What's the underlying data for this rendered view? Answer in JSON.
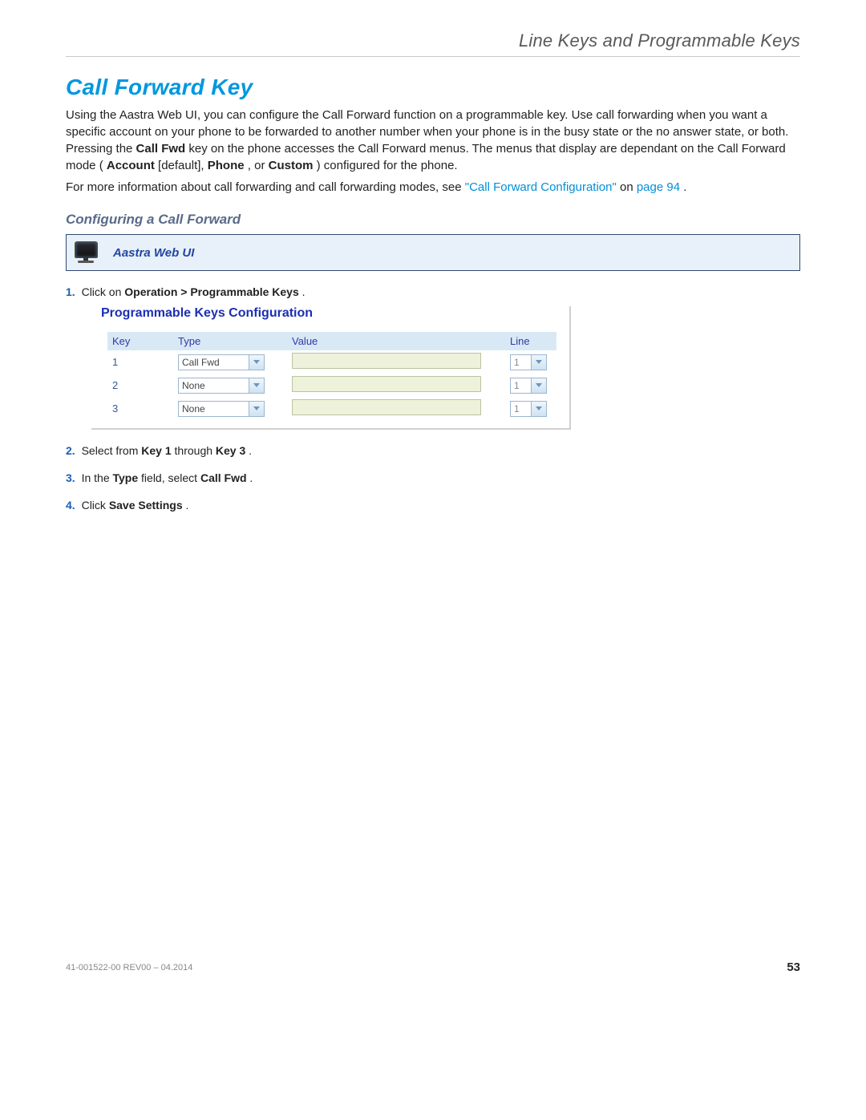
{
  "header": {
    "title": "Line Keys and Programmable Keys"
  },
  "h1": "Call Forward Key",
  "para1": {
    "t1": "Using the Aastra Web UI, you can configure the Call Forward function on a programmable key. Use call forwarding when you want a specific account on your phone to be forwarded to another number when your phone is in the busy state or the no answer state, or both. Pressing the ",
    "bold1": "Call Fwd",
    "t2": " key on the phone accesses the Call Forward menus. The menus that display are dependant on the Call Forward mode (",
    "bold2": "Account",
    "t3": " [default], ",
    "bold3": "Phone",
    "t4": ", or ",
    "bold4": "Custom",
    "t5": ") configured for the phone."
  },
  "para2": {
    "t1": "For more information about call forwarding and call forwarding modes, see ",
    "link1": "\"Call Forward Configuration\"",
    "t2": " on ",
    "link2": "page 94",
    "t3": "."
  },
  "h2": "Configuring a Call Forward",
  "webui_label": "Aastra Web UI",
  "steps": {
    "s1": {
      "num": "1.",
      "t1": "Click on ",
      "b1": "Operation > Programmable Keys",
      "t2": "."
    },
    "s2": {
      "num": "2.",
      "t1": "Select from ",
      "b1": "Key 1",
      "t2": " through ",
      "b2": "Key 3",
      "t3": "."
    },
    "s3": {
      "num": "3.",
      "t1": "In the ",
      "b1": "Type",
      "t2": " field, select ",
      "b2": "Call Fwd",
      "t3": "."
    },
    "s4": {
      "num": "4.",
      "t1": "Click ",
      "b1": "Save Settings",
      "t2": "."
    }
  },
  "prog": {
    "title": "Programmable Keys Configuration",
    "headers": {
      "key": "Key",
      "type": "Type",
      "value": "Value",
      "line": "Line"
    },
    "rows": [
      {
        "key": "1",
        "type": "Call Fwd",
        "line": "1"
      },
      {
        "key": "2",
        "type": "None",
        "line": "1"
      },
      {
        "key": "3",
        "type": "None",
        "line": "1"
      }
    ]
  },
  "footer": {
    "docrev": "41-001522-00 REV00 – 04.2014",
    "page": "53"
  }
}
